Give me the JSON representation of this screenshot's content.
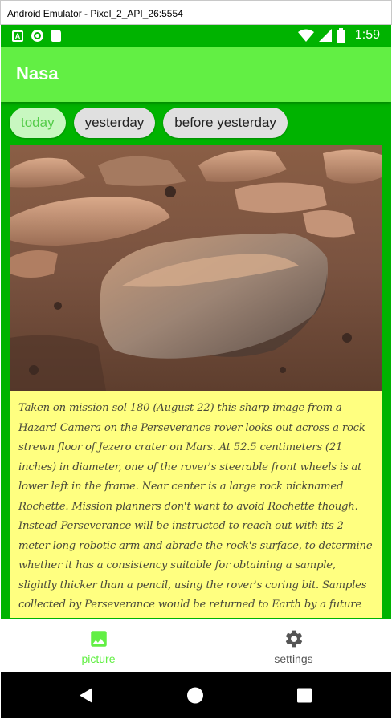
{
  "window": {
    "title": "Android Emulator - Pixel_2_API_26:5554"
  },
  "status_bar": {
    "time": "1:59",
    "icons": [
      "a-notification-icon",
      "circle-notification-icon",
      "sd-card-icon",
      "wifi-icon",
      "signal-icon",
      "battery-icon"
    ]
  },
  "app_bar": {
    "title": "Nasa"
  },
  "chips": [
    {
      "label": "today",
      "selected": true
    },
    {
      "label": "yesterday",
      "selected": false
    },
    {
      "label": "before yesterday",
      "selected": false
    }
  ],
  "picture": {
    "subject": "mars-rock-image"
  },
  "description": {
    "text": "Taken on mission sol 180 (August 22) this sharp image from a Hazard Camera on the Perseverance rover looks out across a rock strewn floor of Jezero crater on Mars. At 52.5 centimeters (21 inches) in diameter, one of the rover's steerable front wheels is at lower left in the frame. Near center is a large rock nicknamed Rochette. Mission planners don't want to avoid Rochette though. Instead Perseverance will be instructed to reach out with its 2 meter long robotic arm and abrade the rock's surface, to determine whether it has a consistency suitable for obtaining a sample, slightly thicker than a pencil, using the rover's coring bit. Samples collected by Perseverance would be returned to Earth by a future Mars mission."
  },
  "bottom_nav": {
    "items": [
      {
        "label": "picture",
        "icon": "image-icon",
        "active": true
      },
      {
        "label": "settings",
        "icon": "gear-icon",
        "active": false
      }
    ]
  },
  "colors": {
    "status_bar": "#00b300",
    "app_bar": "#62ef44",
    "background": "#00b300",
    "description_bg": "#ffff80",
    "active_nav": "#62ef44"
  }
}
